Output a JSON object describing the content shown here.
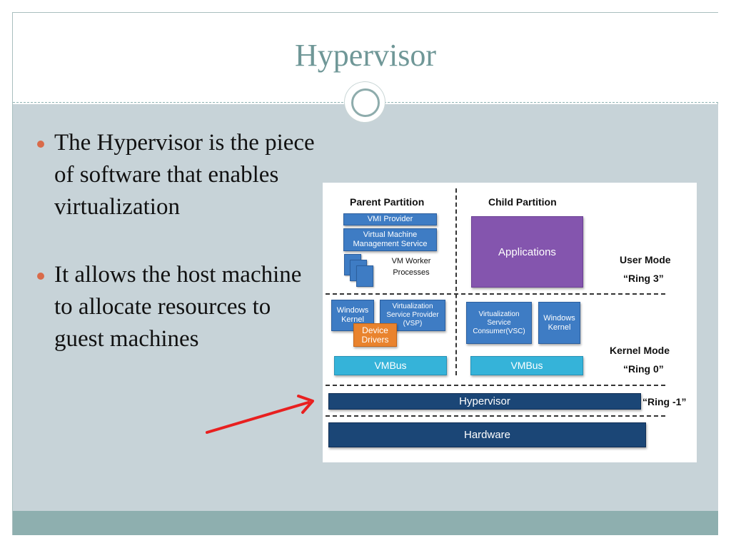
{
  "slide": {
    "title": "Hypervisor",
    "bullets": [
      "The Hypervisor is the piece of software that enables virtualization",
      "It allows the host machine to allocate resources to guest machines"
    ]
  },
  "diagram": {
    "parent_label": "Parent Partition",
    "child_label": "Child Partition",
    "vmi_provider": "VMI Provider",
    "vmms": "Virtual Machine Management Service",
    "vm_worker": "VM Worker Processes",
    "applications": "Applications",
    "windows_kernel": "Windows Kernel",
    "vsp": "Virtualization Service Provider (VSP)",
    "device_drivers": "Device Drivers",
    "vsc": "Virtualization Service Consumer(VSC)",
    "child_windows_kernel": "Windows Kernel",
    "vmbus_parent": "VMBus",
    "vmbus_child": "VMBus",
    "hypervisor": "Hypervisor",
    "hardware": "Hardware",
    "user_mode": "User Mode",
    "ring3": "“Ring 3”",
    "kernel_mode": "Kernel Mode",
    "ring0": "“Ring 0”",
    "ring_minus1": "“Ring -1”"
  },
  "colors": {
    "title": "#6f9797",
    "content_bg": "#c7d3d8",
    "footer": "#8eafaf",
    "bullet_dot": "#d96b4a",
    "arrow": "#e82020"
  }
}
